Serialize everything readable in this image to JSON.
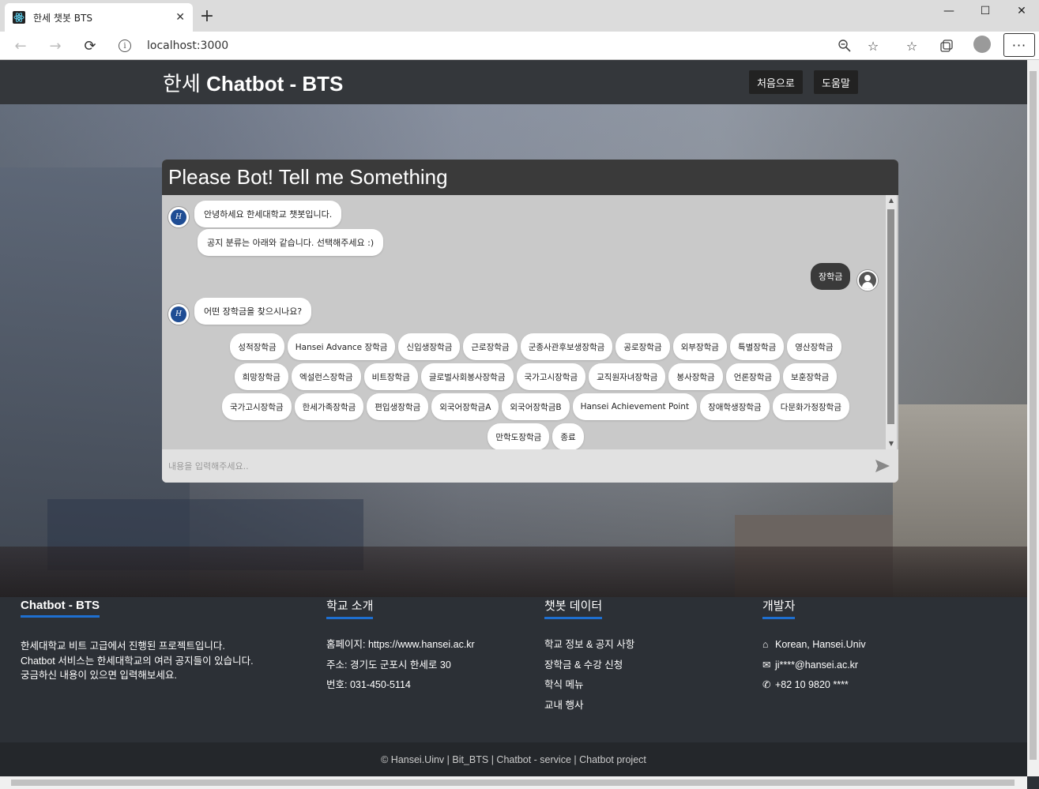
{
  "browser": {
    "tab_title": "한세 챗봇 BTS",
    "tab_close": "✕",
    "new_tab": "+",
    "url": "localhost:3000",
    "controls": {
      "minimize": "—",
      "maximize": "☐",
      "close": "✕"
    },
    "icons": [
      "react-favicon",
      "back-icon",
      "forward-icon",
      "reload-icon",
      "info-icon",
      "zoom-icon",
      "star-icon",
      "favorites-icon",
      "collections-icon",
      "profile-icon",
      "more-icon"
    ]
  },
  "navbar": {
    "brand_prefix": "한세 ",
    "brand_bold": "Chatbot - BTS",
    "links": [
      "처음으로",
      "도움말"
    ]
  },
  "chat": {
    "title": "Please Bot! Tell me Something",
    "bot_greeting": "안녕하세요 한세대학교 챗봇입니다.",
    "bot_prompt": "공지 분류는 아래와 같습니다. 선택해주세요 :)",
    "user_message": "장학금",
    "bot_question": "어떤 장학금을 찾으시나요?",
    "bot_logo": "H",
    "chip_rows": [
      [
        "성적장학금",
        "Hansei Advance 장학금",
        "신입생장학금",
        "근로장학금",
        "군종사관후보생장학금",
        "공로장학금",
        "외부장학금",
        "특별장학금",
        "영산장학금"
      ],
      [
        "희망장학금",
        "엑설런스장학금",
        "비트장학금",
        "글로벌사회봉사장학금",
        "국가고시장학금",
        "교직원자녀장학금",
        "봉사장학금",
        "언론장학금",
        "보훈장학금"
      ],
      [
        "국가고시장학금",
        "한세가족장학금",
        "편입생장학금",
        "외국어장학금A",
        "외국어장학금B",
        "Hansei Achievement Point",
        "장애학생장학금",
        "다문화가정장학금"
      ],
      [
        "만학도장학금",
        "종료"
      ]
    ],
    "input_placeholder": "내용을 입력해주세요..",
    "send_icon": "send-icon"
  },
  "footer": {
    "about": {
      "title": "Chatbot - BTS",
      "lines": [
        "한세대학교 비트 고급에서 진행된 프로젝트입니다.",
        "Chatbot 서비스는 한세대학교의 여러 공지들이 있습니다.",
        "궁금하신 내용이 있으면 입력해보세요."
      ]
    },
    "school": {
      "title": "학교 소개",
      "items": [
        "홈페이지: https://www.hansei.ac.kr",
        "주소: 경기도 군포시 한세로 30",
        "번호: 031-450-5114"
      ]
    },
    "data": {
      "title": "챗봇 데이터",
      "items": [
        "학교 정보 & 공지 사항",
        "장학금 & 수강 신청",
        "학식 메뉴",
        "교내 행사"
      ]
    },
    "dev": {
      "title": "개발자",
      "items": [
        "Korean, Hansei.Univ",
        "ji****@hansei.ac.kr",
        "+82 10 9820 ****"
      ],
      "icons": [
        "home-icon",
        "envelope-icon",
        "phone-icon"
      ]
    },
    "copyright": "© Hansei.Uinv | Bit_BTS | Chatbot - service | Chatbot project"
  }
}
